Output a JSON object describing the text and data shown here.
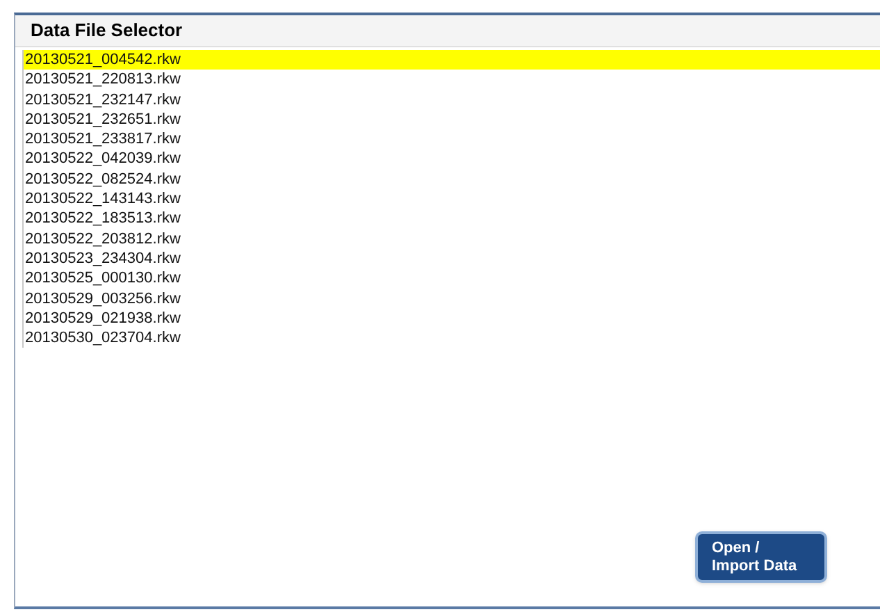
{
  "panel": {
    "title": "Data File Selector"
  },
  "files": [
    {
      "name": "20130521_004542.rkw",
      "selected": true
    },
    {
      "name": "20130521_220813.rkw",
      "selected": false
    },
    {
      "name": "20130521_232147.rkw",
      "selected": false
    },
    {
      "name": "20130521_232651.rkw",
      "selected": false
    },
    {
      "name": "20130521_233817.rkw",
      "selected": false
    },
    {
      "name": "20130522_042039.rkw",
      "selected": false
    },
    {
      "name": "20130522_082524.rkw",
      "selected": false
    },
    {
      "name": "20130522_143143.rkw",
      "selected": false
    },
    {
      "name": "20130522_183513.rkw",
      "selected": false
    },
    {
      "name": "20130522_203812.rkw",
      "selected": false
    },
    {
      "name": "20130523_234304.rkw",
      "selected": false
    },
    {
      "name": "20130525_000130.rkw",
      "selected": false
    },
    {
      "name": "20130529_003256.rkw",
      "selected": false
    },
    {
      "name": "20130529_021938.rkw",
      "selected": false
    },
    {
      "name": "20130530_023704.rkw",
      "selected": false
    }
  ],
  "button": {
    "label": "Open / Import Data"
  }
}
